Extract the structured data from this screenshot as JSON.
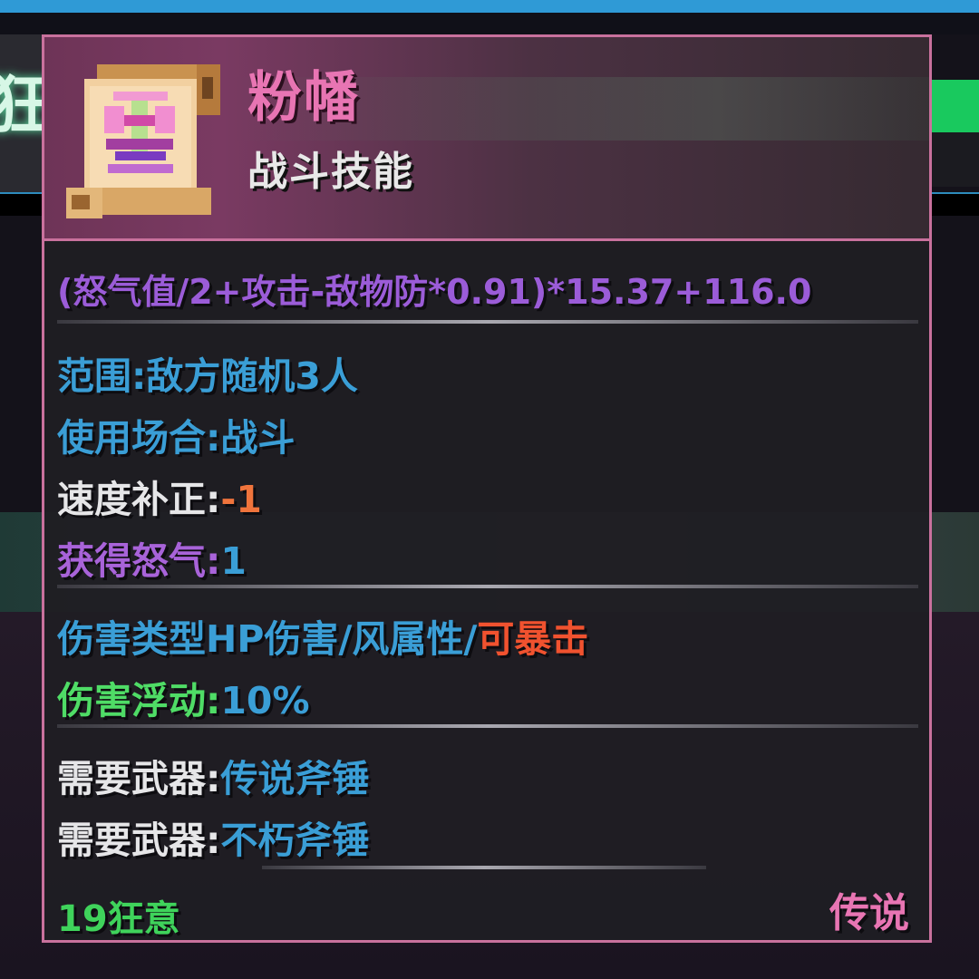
{
  "background": {
    "left_glyph": "狂"
  },
  "item": {
    "name": "粉幡",
    "type": "战斗技能",
    "icon": "scroll-icon",
    "formula": "(怒气值/2+攻击-敌物防*0.91)*15.37+116.0"
  },
  "stats": {
    "range": "范围:敌方随机3人",
    "use_scene": "使用场合:战斗",
    "speed_label": "速度补正:",
    "speed_value": "-1",
    "rage_label": "获得怒气:",
    "rage_value": "1"
  },
  "damage": {
    "type_text": "伤害类型HP伤害/风属性/",
    "crit": "可暴击",
    "float_label": "伤害浮动:",
    "float_value": "10%"
  },
  "weapons": [
    {
      "label": "需要武器:",
      "value": "传说斧锤"
    },
    {
      "label": "需要武器:",
      "value": "不朽斧锤"
    }
  ],
  "footer": {
    "left": "19狂意",
    "rarity": "传说"
  },
  "colors": {
    "border": "#c9719d",
    "name": "#e875b3",
    "formula": "#9b5cd8",
    "info_blue": "#3a9ed6",
    "crit_red": "#f0522f",
    "green": "#4fdc66"
  }
}
